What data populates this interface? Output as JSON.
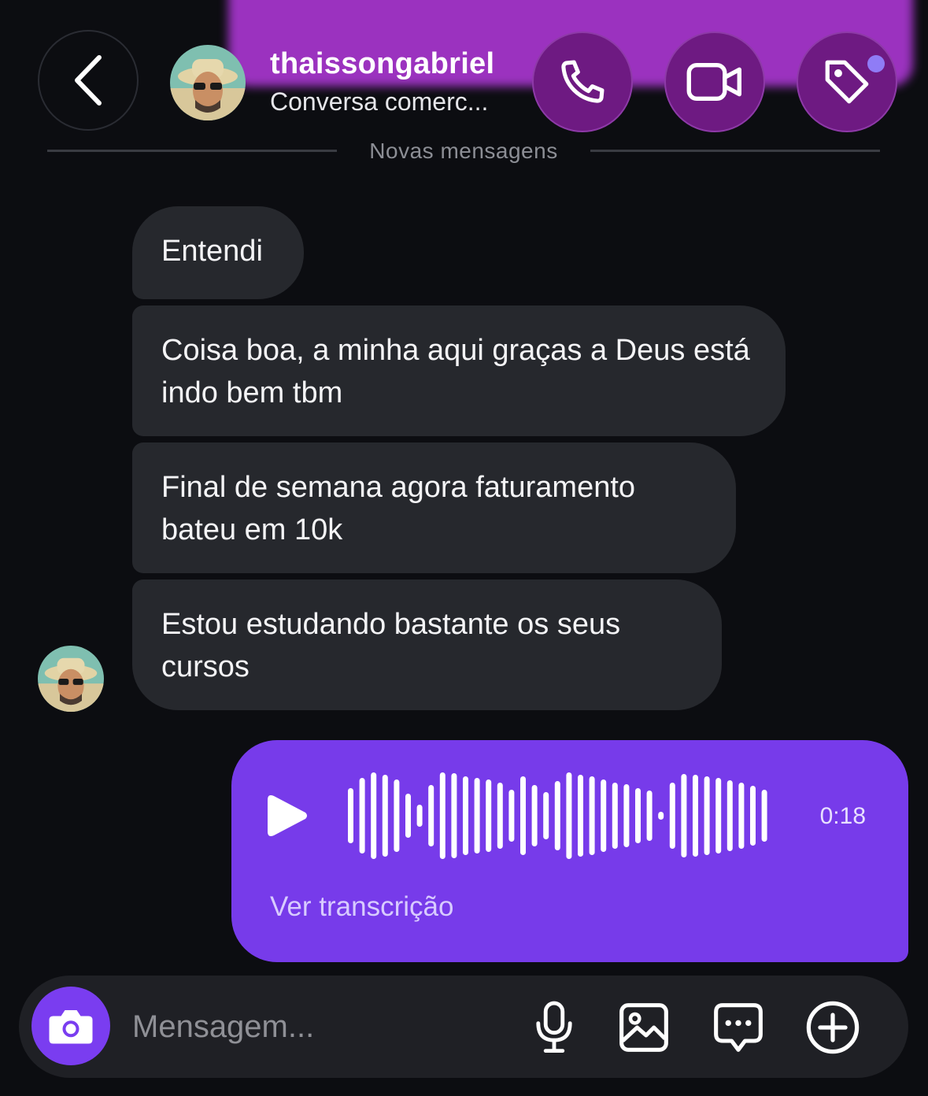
{
  "header": {
    "username": "thaissongabriel",
    "subtitle": "Conversa comerc...",
    "icons": [
      "back-chevron-icon",
      "phone-icon",
      "video-camera-icon",
      "tag-icon"
    ],
    "accent_color": "#a335c9"
  },
  "divider": {
    "label": "Novas mensagens"
  },
  "messages": {
    "incoming": [
      {
        "text": "Entendi"
      },
      {
        "text": "Coisa boa, a minha aqui graças a Deus está indo bem tbm"
      },
      {
        "text": "Final de semana agora faturamento bateu em 10k"
      },
      {
        "text": "Estou estudando bastante os seus cursos"
      }
    ],
    "voice": {
      "duration": "0:18",
      "transcript_label": "Ver transcrição",
      "bubble_color": "#773bea"
    }
  },
  "composer": {
    "placeholder": "Mensagem...",
    "icons": [
      "camera-icon",
      "microphone-icon",
      "image-icon",
      "chat-bubble-icon",
      "plus-circle-icon"
    ]
  }
}
